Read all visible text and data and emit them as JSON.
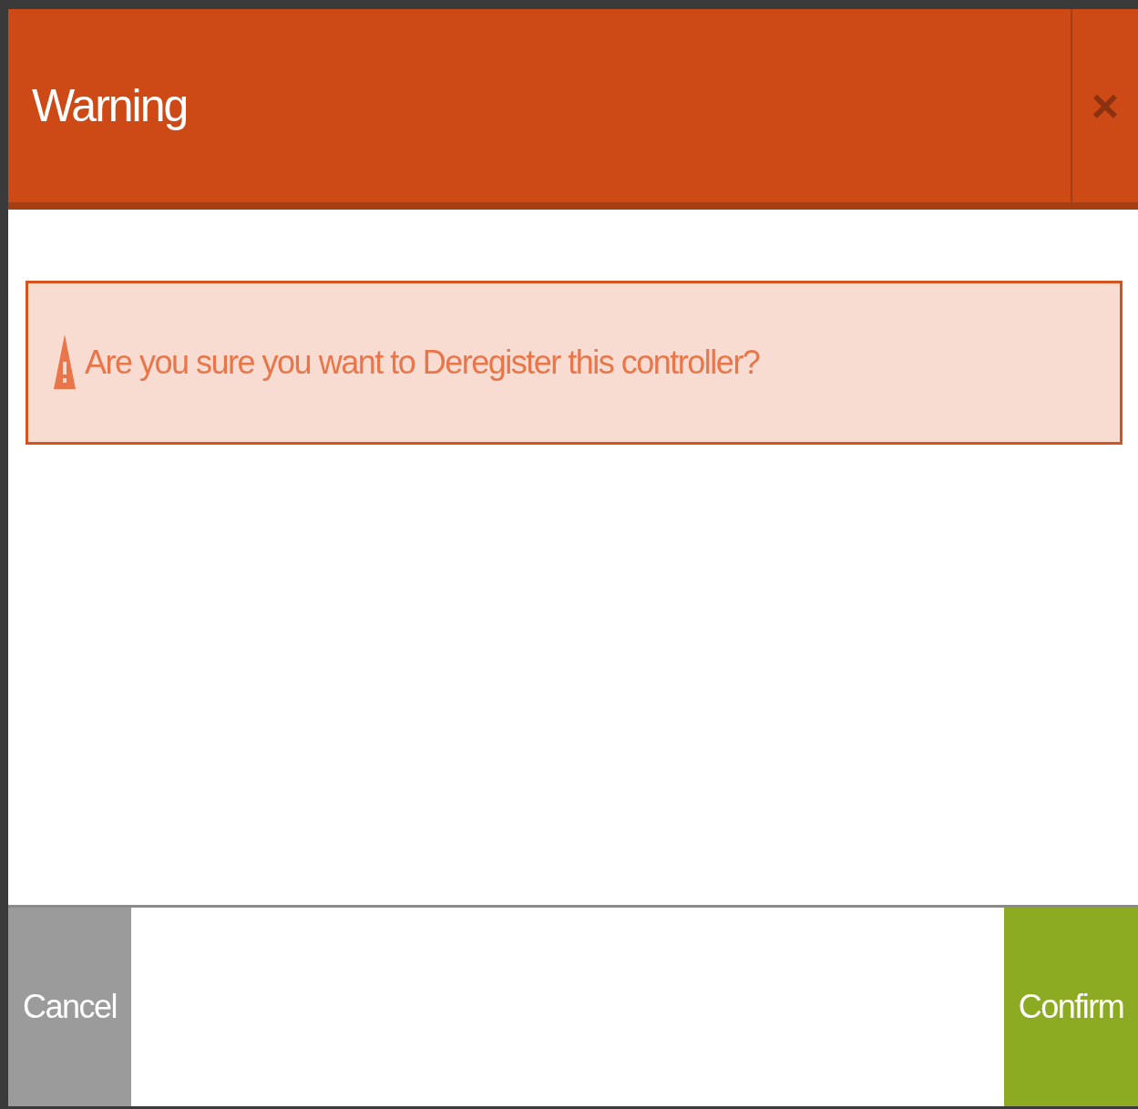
{
  "dialog": {
    "title": "Warning",
    "close": "×",
    "alert": {
      "kind": "warning",
      "message": "Are you sure you want to Deregister this controller?"
    },
    "buttons": [
      {
        "label": "Cancel",
        "kind": "secondary"
      },
      {
        "label": "Confirm",
        "kind": "primary"
      }
    ]
  }
}
